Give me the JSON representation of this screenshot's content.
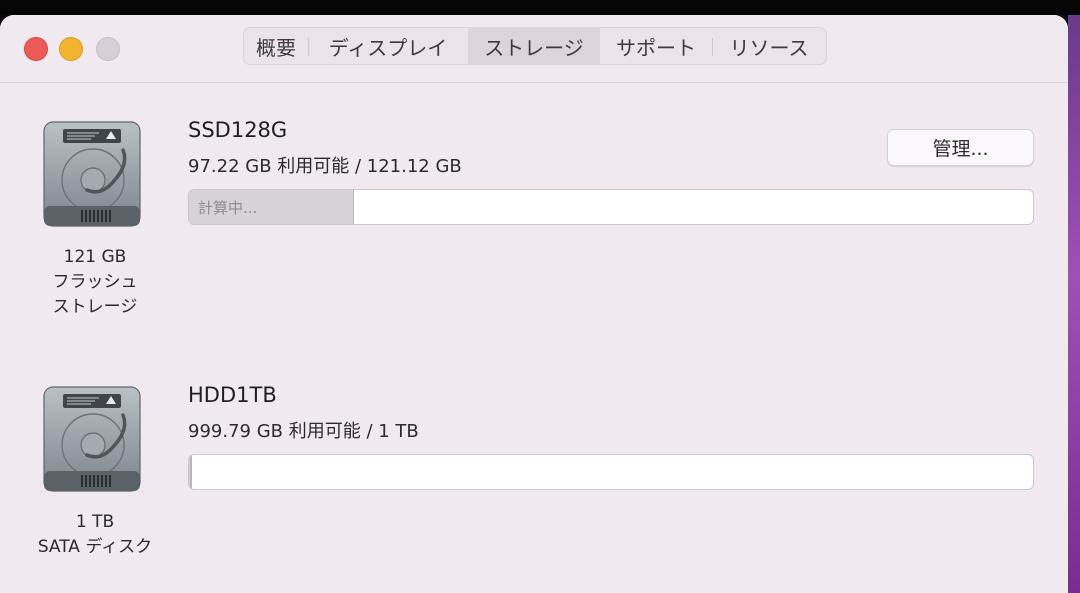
{
  "window": {
    "traffic_lights": [
      "close",
      "minimize",
      "zoom"
    ]
  },
  "tabs": [
    {
      "label": "概要",
      "active": false
    },
    {
      "label": "ディスプレイ",
      "active": false
    },
    {
      "label": "ストレージ",
      "active": true
    },
    {
      "label": "サポート",
      "active": false
    },
    {
      "label": "リソース",
      "active": false
    }
  ],
  "drives": [
    {
      "name": "SSD128G",
      "usage": "97.22 GB 利用可能 / 121.12 GB",
      "capacity": "121 GB",
      "type_line1": "フラッシュ",
      "type_line2": "ストレージ",
      "bar_label": "計算中...",
      "bar_fill_fraction": 0.195,
      "manage_label": "管理..."
    },
    {
      "name": "HDD1TB",
      "usage": "999.79 GB 利用可能 / 1 TB",
      "capacity": "1 TB",
      "type_line1": "SATA ディスク",
      "type_line2": "",
      "bar_label": "",
      "bar_fill_fraction": 0.003
    }
  ],
  "colors": {
    "window_bg": "#f1e9f0",
    "close": "#ee5b57",
    "minimize": "#f3b42d",
    "zoom": "#d6d0d5",
    "bar_fill": "#d6d3d7"
  }
}
